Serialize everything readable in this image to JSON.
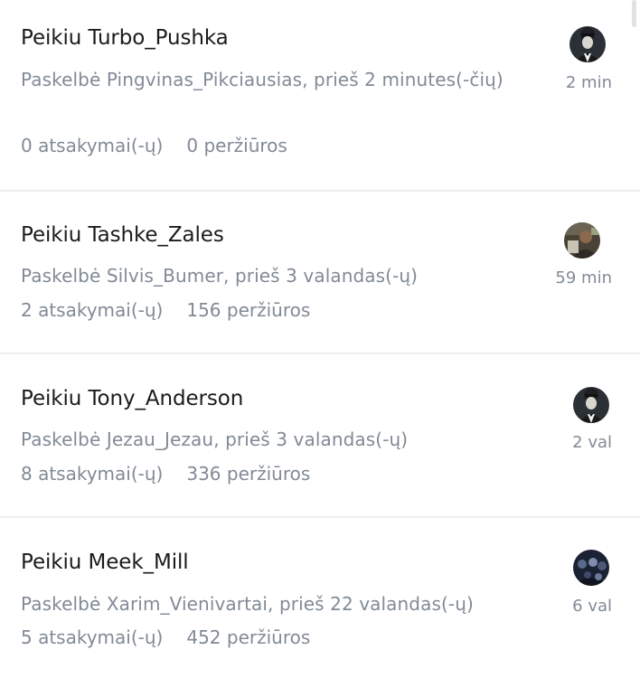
{
  "threads": [
    {
      "title": "Peikiu Turbo_Pushka",
      "meta": "Paskelbė Pingvinas_Pikciausias, prieš 2 minutes(-čių)",
      "replies": "0 atsakymai(-ų)",
      "views": "0 peržiūros",
      "time": "2 min",
      "avatar_icon": "avatar-penguin-suit-icon"
    },
    {
      "title": "Peikiu Tashke_Zales",
      "meta": "Paskelbė Silvis_Bumer, prieš 3 valandas(-ų)",
      "replies": "2 atsakymai(-ų)",
      "views": "156 peržiūros",
      "time": "59 min",
      "avatar_icon": "avatar-photo-icon"
    },
    {
      "title": "Peikiu Tony_Anderson",
      "meta": "Paskelbė Jezau_Jezau, prieš 3 valandas(-ų)",
      "replies": "8 atsakymai(-ų)",
      "views": "336 peržiūros",
      "time": "2 val",
      "avatar_icon": "avatar-penguin-suit-icon"
    },
    {
      "title": "Peikiu Meek_Mill",
      "meta": "Paskelbė Xarim_Vienivartai, prieš 22 valandas(-ų)",
      "replies": "5 atsakymai(-ų)",
      "views": "452 peržiūros",
      "time": "6 val",
      "avatar_icon": "avatar-group-photo-icon"
    }
  ],
  "colors": {
    "title": "#1b1b1b",
    "muted": "#818a96",
    "divider": "#eceef0"
  }
}
